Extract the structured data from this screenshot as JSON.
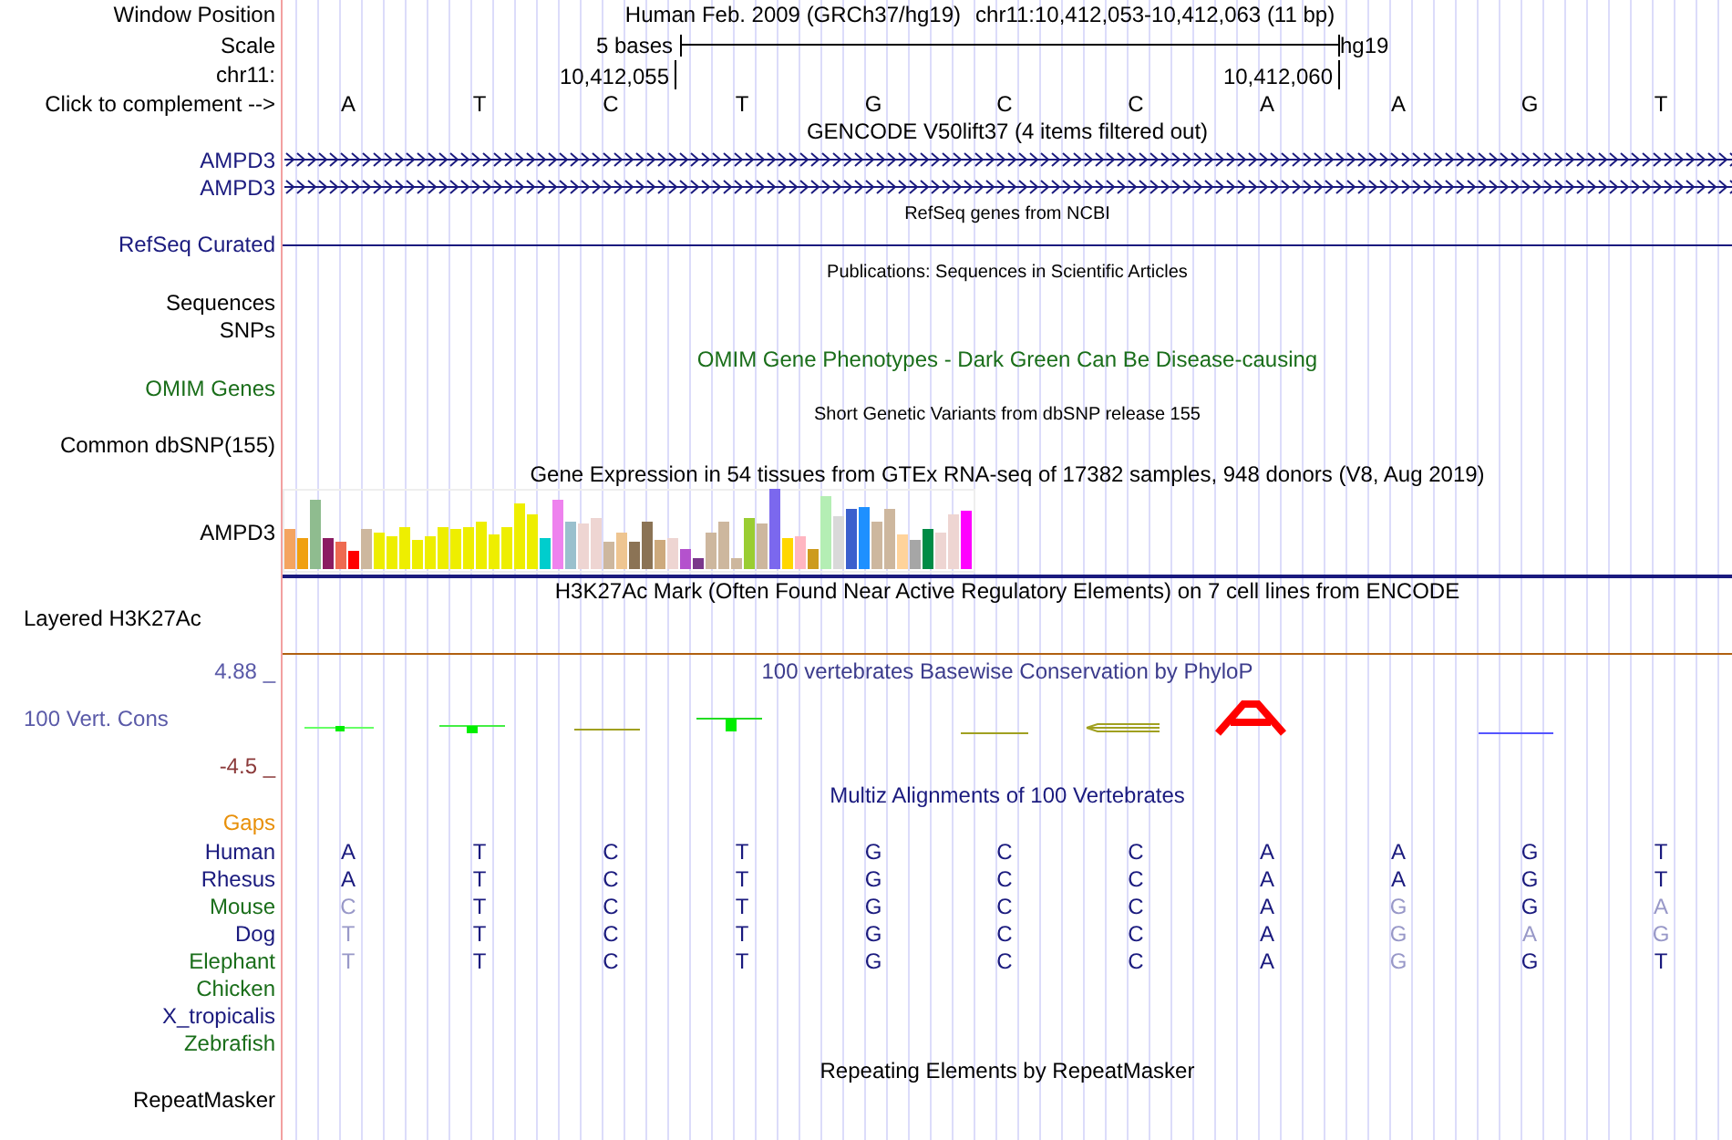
{
  "header": {
    "position_label": "Window Position",
    "assembly_title": "Human Feb. 2009 (GRCh37/hg19)",
    "position": "chr11:10,412,053-10,412,063 (11 bp)",
    "scale_label": "Scale",
    "scale_length": "5 bases",
    "scale_assembly": "hg19",
    "chrom_label": "chr11:",
    "ruler_start": "10,412,055",
    "ruler_end": "10,412,060",
    "complement_label": "Click to complement -->",
    "bases": [
      "A",
      "T",
      "C",
      "T",
      "G",
      "C",
      "C",
      "A",
      "A",
      "G",
      "T"
    ]
  },
  "tracks": [
    {
      "kind": "title",
      "text": "GENCODE V50lift37 (4 items filtered out)",
      "color": "#000000"
    },
    {
      "kind": "gene",
      "label": "AMPD3",
      "color": "#1a1a7e"
    },
    {
      "kind": "gene",
      "label": "AMPD3",
      "color": "#1a1a7e"
    },
    {
      "kind": "subtitle",
      "text": "RefSeq genes from NCBI",
      "color": "#000000"
    },
    {
      "kind": "line",
      "label": "RefSeq Curated",
      "color": "#1a1a7e"
    },
    {
      "kind": "subtitle",
      "text": "Publications: Sequences in Scientific Articles",
      "color": "#000000"
    },
    {
      "kind": "label",
      "label": "Sequences",
      "color": "#000000"
    },
    {
      "kind": "label",
      "label": "SNPs",
      "color": "#000000"
    },
    {
      "kind": "title",
      "text": "OMIM Gene Phenotypes - Dark Green Can Be Disease-causing",
      "color": "#1a6e1a"
    },
    {
      "kind": "label",
      "label": "OMIM Genes",
      "color": "#1a6e1a"
    },
    {
      "kind": "subtitle",
      "text": "Short Genetic Variants from dbSNP release 155",
      "color": "#000000"
    },
    {
      "kind": "label",
      "label": "Common dbSNP(155)",
      "color": "#000000"
    },
    {
      "kind": "title",
      "text": "Gene Expression in 54 tissues from GTEx RNA-seq of 17382 samples, 948 donors (V8, Aug 2019)",
      "color": "#000000"
    },
    {
      "kind": "bars",
      "label": "AMPD3"
    },
    {
      "kind": "title",
      "text": "H3K27Ac Mark (Often Found Near Active Regulatory Elements) on 7 cell lines from ENCODE",
      "color": "#000000"
    },
    {
      "kind": "layered",
      "label": "Layered H3K27Ac"
    },
    {
      "kind": "wiggle",
      "title": "100 vertebrates Basewise Conservation by PhyloP",
      "upper": "4.88 _",
      "label": "100 Vert. Cons",
      "lower": "-4.5 _"
    },
    {
      "kind": "title",
      "text": "Multiz Alignments of 100 Vertebrates",
      "color": "#1a1a7e"
    },
    {
      "kind": "label",
      "label": "Gaps",
      "color": "#e8900a"
    },
    {
      "kind": "species",
      "name": "Human",
      "color": "#1a1a7e",
      "bases": [
        {
          "text": "A",
          "match": true
        },
        {
          "text": "T",
          "match": true
        },
        {
          "text": "C",
          "match": true
        },
        {
          "text": "T",
          "match": true
        },
        {
          "text": "G",
          "match": true
        },
        {
          "text": "C",
          "match": true
        },
        {
          "text": "C",
          "match": true
        },
        {
          "text": "A",
          "match": true
        },
        {
          "text": "A",
          "match": true
        },
        {
          "text": "G",
          "match": true
        },
        {
          "text": "T",
          "match": true
        }
      ]
    },
    {
      "kind": "species",
      "name": "Rhesus",
      "color": "#1a1a7e",
      "bases": [
        {
          "text": "A",
          "match": true
        },
        {
          "text": "T",
          "match": true
        },
        {
          "text": "C",
          "match": true
        },
        {
          "text": "T",
          "match": true
        },
        {
          "text": "G",
          "match": true
        },
        {
          "text": "C",
          "match": true
        },
        {
          "text": "C",
          "match": true
        },
        {
          "text": "A",
          "match": true
        },
        {
          "text": "A",
          "match": true
        },
        {
          "text": "G",
          "match": true
        },
        {
          "text": "T",
          "match": true
        }
      ]
    },
    {
      "kind": "species",
      "name": "Mouse",
      "color": "#1a6e1a",
      "bases": [
        {
          "text": "C",
          "match": false
        },
        {
          "text": "T",
          "match": true
        },
        {
          "text": "C",
          "match": true
        },
        {
          "text": "T",
          "match": true
        },
        {
          "text": "G",
          "match": true
        },
        {
          "text": "C",
          "match": true
        },
        {
          "text": "C",
          "match": true
        },
        {
          "text": "A",
          "match": true
        },
        {
          "text": "G",
          "match": false
        },
        {
          "text": "G",
          "match": true
        },
        {
          "text": "A",
          "match": false
        }
      ]
    },
    {
      "kind": "species",
      "name": "Dog",
      "color": "#1a1a7e",
      "bases": [
        {
          "text": "T",
          "match": false
        },
        {
          "text": "T",
          "match": true
        },
        {
          "text": "C",
          "match": true
        },
        {
          "text": "T",
          "match": true
        },
        {
          "text": "G",
          "match": true
        },
        {
          "text": "C",
          "match": true
        },
        {
          "text": "C",
          "match": true
        },
        {
          "text": "A",
          "match": true
        },
        {
          "text": "G",
          "match": false
        },
        {
          "text": "A",
          "match": false
        },
        {
          "text": "G",
          "match": false
        }
      ]
    },
    {
      "kind": "species",
      "name": "Elephant",
      "color": "#1a6e1a",
      "bases": [
        {
          "text": "T",
          "match": false
        },
        {
          "text": "T",
          "match": true
        },
        {
          "text": "C",
          "match": true
        },
        {
          "text": "T",
          "match": true
        },
        {
          "text": "G",
          "match": true
        },
        {
          "text": "C",
          "match": true
        },
        {
          "text": "C",
          "match": true
        },
        {
          "text": "A",
          "match": true
        },
        {
          "text": "G",
          "match": false
        },
        {
          "text": "G",
          "match": true
        },
        {
          "text": "T",
          "match": true
        }
      ]
    },
    {
      "kind": "species",
      "name": "Chicken",
      "color": "#1a6e1a"
    },
    {
      "kind": "species",
      "name": "X_tropicalis",
      "color": "#1a1a7e"
    },
    {
      "kind": "species",
      "name": "Zebrafish",
      "color": "#1a6e1a"
    },
    {
      "kind": "title",
      "text": "Repeating Elements by RepeatMasker",
      "color": "#000000"
    },
    {
      "kind": "label",
      "label": "RepeatMasker",
      "color": "#000000"
    }
  ]
}
